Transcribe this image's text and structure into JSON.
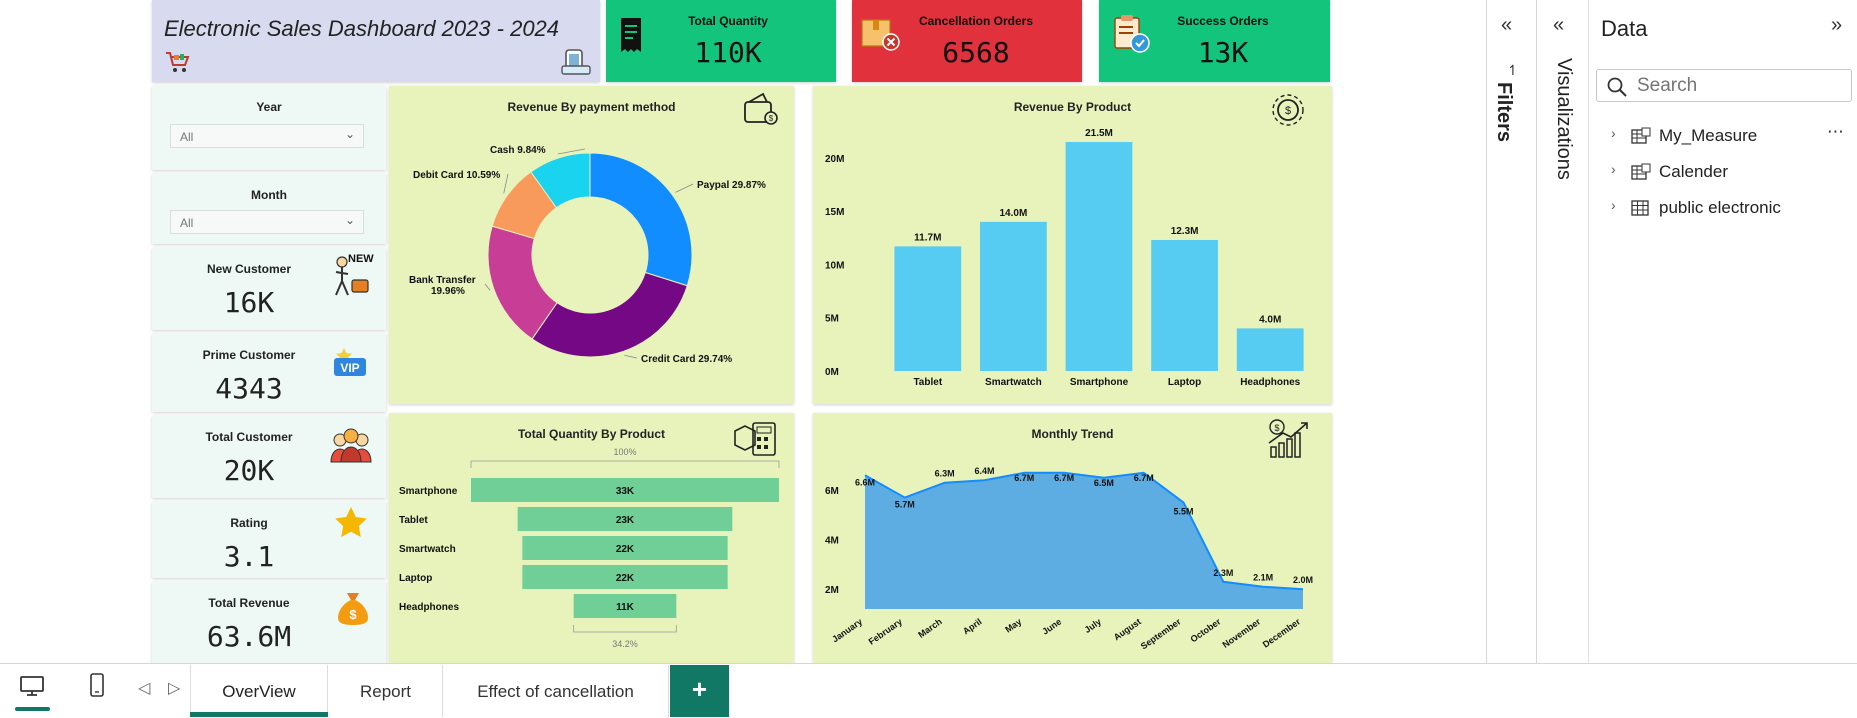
{
  "header": {
    "title": "Electronic Sales Dashboard 2023 - 2024"
  },
  "kpis": [
    {
      "label": "Total Quantity",
      "value": "110K",
      "color": "#12c47c",
      "icon": "receipt-icon"
    },
    {
      "label": "Cancellation Orders",
      "value": "6568",
      "color": "#e0313c",
      "icon": "cancelled-box-icon"
    },
    {
      "label": "Success Orders",
      "value": "13K",
      "color": "#12c47c",
      "icon": "clipboard-check-icon"
    }
  ],
  "slicers": {
    "year": {
      "label": "Year",
      "value": "All"
    },
    "month": {
      "label": "Month",
      "value": "All"
    }
  },
  "cards": [
    {
      "label": "New Customer",
      "value": "16K",
      "icon": "new-customer-icon",
      "badge": "NEW"
    },
    {
      "label": "Prime Customer",
      "value": "4343",
      "icon": "vip-icon",
      "badge": "VIP"
    },
    {
      "label": "Total Customer",
      "value": "20K",
      "icon": "customers-group-icon"
    },
    {
      "label": "Rating",
      "value": "3.1",
      "icon": "star-icon"
    },
    {
      "label": "Total Revenue",
      "value": "63.6M",
      "icon": "money-bag-icon",
      "badge": "$"
    }
  ],
  "chart_data": [
    {
      "type": "pie",
      "title": "Revenue By payment method",
      "slices": [
        {
          "label": "Paypal",
          "pct_label": "29.87%",
          "value": 29.87,
          "color": "#118dff"
        },
        {
          "label": "Credit Card",
          "pct_label": "29.74%",
          "value": 29.74,
          "color": "#750985"
        },
        {
          "label": "Bank Transfer",
          "pct_label": "19.96%",
          "value": 19.96,
          "color": "#c83d95"
        },
        {
          "label": "Debit Card",
          "pct_label": "10.59%",
          "value": 10.59,
          "color": "#f89a5b"
        },
        {
          "label": "Cash",
          "pct_label": "9.84%",
          "value": 9.84,
          "color": "#1ad3ee"
        }
      ]
    },
    {
      "type": "bar",
      "title": "Revenue By Product",
      "categories": [
        "Tablet",
        "Smartwatch",
        "Smartphone",
        "Laptop",
        "Headphones"
      ],
      "values": [
        11.7,
        14.0,
        21.5,
        12.3,
        4.0
      ],
      "data_labels": [
        "11.7M",
        "14.0M",
        "21.5M",
        "12.3M",
        "4.0M"
      ],
      "ylim": [
        0,
        23
      ],
      "yticks": [
        0,
        5,
        10,
        15,
        20
      ],
      "ytick_labels": [
        "0M",
        "5M",
        "10M",
        "15M",
        "20M"
      ],
      "color": "#56ccf2"
    },
    {
      "type": "bar",
      "subtype": "funnel",
      "title": "Total Quantity By Product",
      "categories": [
        "Smartphone",
        "Tablet",
        "Smartwatch",
        "Laptop",
        "Headphones"
      ],
      "values": [
        33,
        23,
        22,
        22,
        11
      ],
      "data_labels": [
        "33K",
        "23K",
        "22K",
        "22K",
        "11K"
      ],
      "top_pct": "100%",
      "bottom_pct": "34.2%",
      "color": "#6fcf97"
    },
    {
      "type": "area",
      "title": "Monthly Trend",
      "categories": [
        "January",
        "February",
        "March",
        "April",
        "May",
        "June",
        "July",
        "August",
        "September",
        "October",
        "November",
        "December"
      ],
      "values": [
        6.6,
        5.7,
        6.3,
        6.4,
        6.7,
        6.7,
        6.5,
        6.7,
        5.5,
        2.3,
        2.1,
        2.0
      ],
      "data_labels": [
        "6.6M",
        "5.7M",
        "6.3M",
        "6.4M",
        "6.7M",
        "6.7M",
        "6.5M",
        "6.7M",
        "5.5M",
        "2.3M",
        "2.1M",
        "2.0M"
      ],
      "ylim": [
        1.2,
        7.5
      ],
      "yticks": [
        2,
        4,
        6
      ],
      "ytick_labels": [
        "2M",
        "4M",
        "6M"
      ],
      "color": "#5dade2",
      "line_color": "#118dff"
    }
  ],
  "chart_icons": [
    "wallet-icon",
    "gear-dollar-icon",
    "boxes-calculator-icon",
    "growth-chart-icon"
  ],
  "panes": {
    "filters": {
      "label": "Filters",
      "collapse_icon": "double-chevron-left-icon"
    },
    "visualizations": {
      "label": "Visualizations",
      "collapse_icon": "double-chevron-left-icon"
    },
    "data": {
      "title": "Data",
      "expand_icon": "double-chevron-right-icon",
      "search_placeholder": "Search",
      "items": [
        {
          "label": "My_Measure",
          "icon": "measure-table-icon"
        },
        {
          "label": "Calender",
          "icon": "calendar-table-icon"
        },
        {
          "label": "public electronic",
          "icon": "table-icon"
        }
      ],
      "more_icon": "ellipsis-icon"
    }
  },
  "tabs": {
    "pages": [
      "OverView",
      "Report",
      "Effect of cancellation"
    ],
    "active": "OverView",
    "add_label": "+",
    "accent": "#117865"
  }
}
